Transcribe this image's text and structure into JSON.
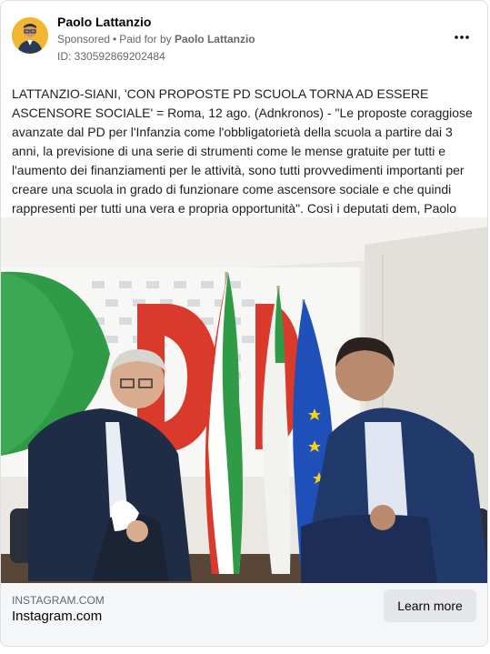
{
  "header": {
    "page_name": "Paolo Lattanzio",
    "sponsored_label": "Sponsored",
    "paid_for_prefix": "Paid for by",
    "paid_for_name": "Paolo Lattanzio",
    "ad_id": "ID: 330592869202484",
    "more_icon": "more-options-icon"
  },
  "post": {
    "text": "LATTANZIO-SIANI, 'CON PROPOSTE PD SCUOLA TORNA AD ESSERE ASCENSORE SOCIALE' = Roma, 12 ago. (Adnkronos) - \"Le proposte coraggiose avanzate dal PD per l'Infanzia come l'obbligatorietà della scuola a partire dai 3 anni, la previsione di una serie di strumenti come le mense gratuite per tutti e l'aumento dei finanziamenti per le attività, sono tutti provvedimenti importanti per creare una scuola in grado di funzionare come ascensore sociale e che quindi rappresenti per tutti una vera e propria opportunità\". Così i deputati dem, Paolo LATTANZIO…"
  },
  "link": {
    "domain": "INSTAGRAM.COM",
    "title": "Instagram.com",
    "cta_label": "Learn more"
  },
  "colors": {
    "pd_green": "#2f9b47",
    "pd_red": "#d93a2b",
    "eu_blue": "#1f4fb8",
    "eu_star": "#f4d21a"
  }
}
